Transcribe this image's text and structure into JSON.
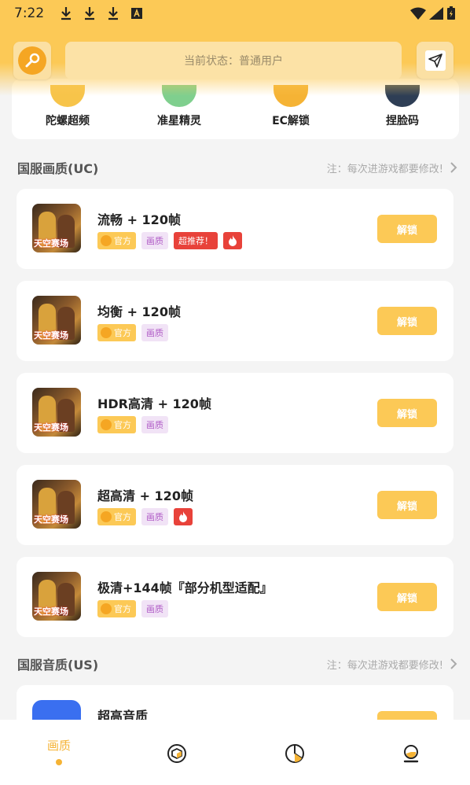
{
  "status_bar": {
    "time": "7:22"
  },
  "header": {
    "status_text": "当前状态：普通用户"
  },
  "features": [
    {
      "label": "陀螺超频",
      "icon": "gyro-icon",
      "color": "#f7c44a"
    },
    {
      "label": "准星精灵",
      "icon": "crosshair-icon",
      "color": "#7fcf8e"
    },
    {
      "label": "EC解锁",
      "icon": "ec-unlock-icon",
      "color": "#f5b335"
    },
    {
      "label": "捏脸码",
      "icon": "face-code-icon",
      "color": "#2e3e55"
    }
  ],
  "sections": [
    {
      "title": "国服画质(UC)",
      "note": "注：每次进游戏都要修改!"
    },
    {
      "title": "国服音质(US)",
      "note": "注：每次进游戏都要修改!"
    }
  ],
  "thumb_text": "天空赛场",
  "items": [
    {
      "title": "流畅 + 120帧",
      "tag_official": "官方",
      "tag_quality": "画质",
      "tag_recommend": "超推荐！",
      "hot": true,
      "button": "解锁"
    },
    {
      "title": "均衡 + 120帧",
      "tag_official": "官方",
      "tag_quality": "画质",
      "button": "解锁"
    },
    {
      "title": "HDR高清 + 120帧",
      "tag_official": "官方",
      "tag_quality": "画质",
      "button": "解锁"
    },
    {
      "title": "超高清 + 120帧",
      "tag_official": "官方",
      "tag_quality": "画质",
      "hot": true,
      "button": "解锁"
    },
    {
      "title": "极清+144帧『部分机型适配』",
      "tag_official": "官方",
      "tag_quality": "画质",
      "button": "解锁"
    }
  ],
  "audio_items": [
    {
      "title": "超高音质"
    }
  ],
  "bottom_nav": [
    {
      "label": "画质",
      "active": true
    },
    {
      "icon": "cube-icon"
    },
    {
      "icon": "pie-chart-icon"
    },
    {
      "icon": "user-icon"
    }
  ],
  "colors": {
    "accent": "#fcc956",
    "hot": "#e8423a",
    "quality_tag": "#b05cc6"
  }
}
